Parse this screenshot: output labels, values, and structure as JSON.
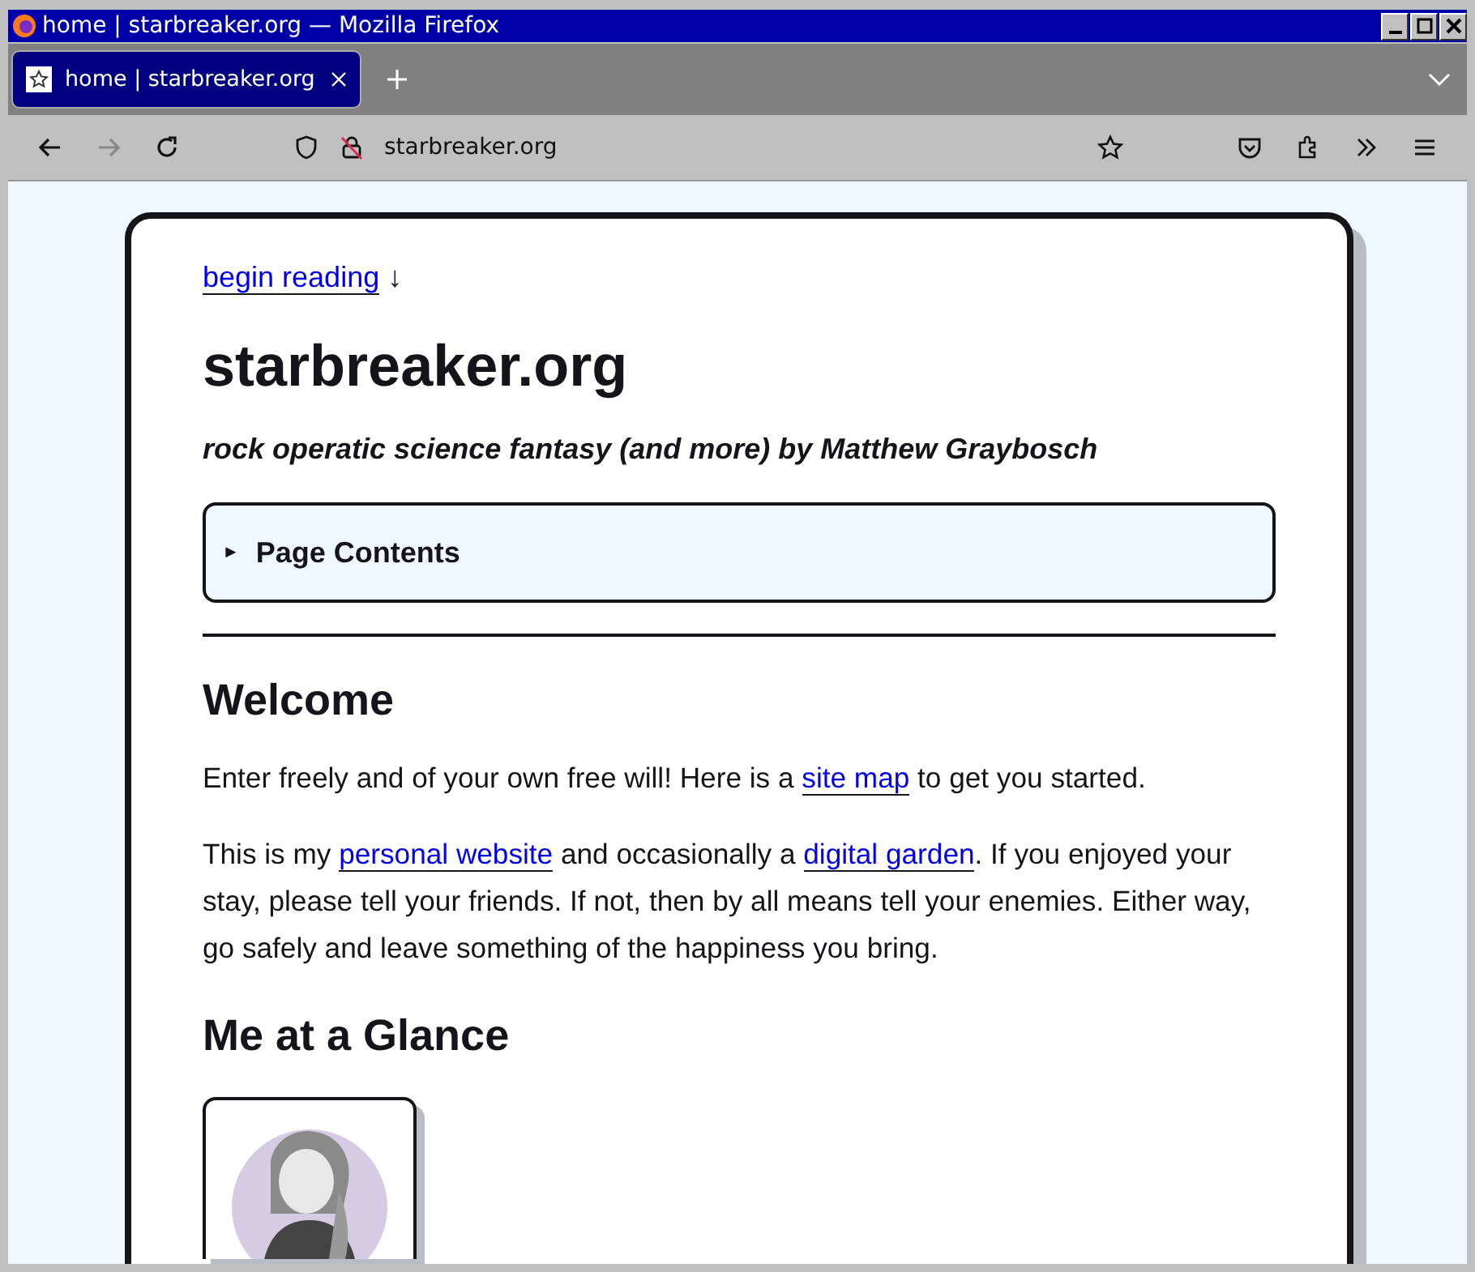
{
  "window": {
    "title": "home | starbreaker.org — Mozilla Firefox"
  },
  "tabs": [
    {
      "label": "home | starbreaker.org",
      "selected": true
    }
  ],
  "toolbar": {
    "url": "starbreaker.org",
    "forward_disabled": true
  },
  "page": {
    "skip_link": "begin reading",
    "skip_arrow": "↓",
    "title": "starbreaker.org",
    "subtitle": "rock operatic science fantasy (and more) by Matthew Graybosch",
    "details": {
      "marker": "►",
      "summary": "Page Contents",
      "expanded": false
    },
    "sections": [
      {
        "heading": "Welcome",
        "paragraphs": [
          [
            {
              "text": "Enter freely and of your own free will! Here is a ",
              "link": false
            },
            {
              "text": "site map",
              "link": true
            },
            {
              "text": " to get you started.",
              "link": false
            }
          ],
          [
            {
              "text": "This is my ",
              "link": false
            },
            {
              "text": "personal website",
              "link": true
            },
            {
              "text": " and occasionally a ",
              "link": false
            },
            {
              "text": "digital garden",
              "link": true
            },
            {
              "text": ". If you enjoyed your stay, please tell your friends. If not, then by all means tell your enemies. Either way, go safely and leave something of the happiness you bring.",
              "link": false
            }
          ]
        ]
      },
      {
        "heading": "Me at a Glance"
      }
    ]
  }
}
